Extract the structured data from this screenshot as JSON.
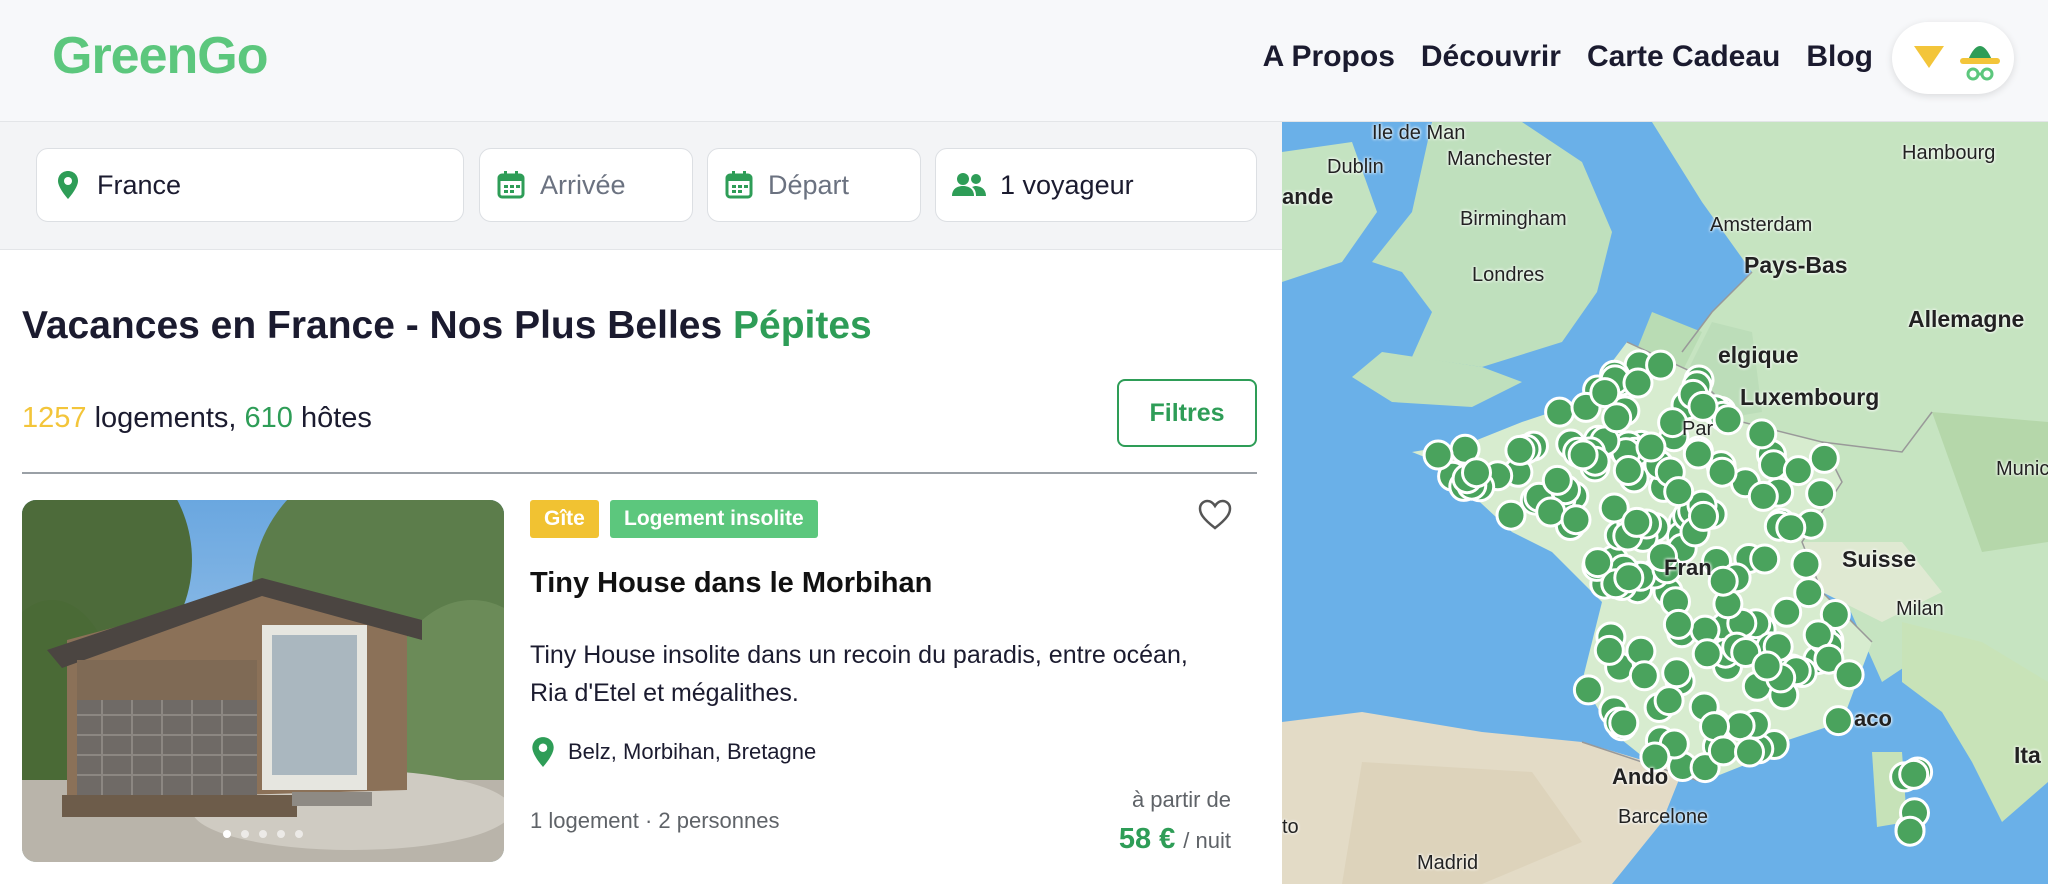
{
  "header": {
    "logo": {
      "green": "Green",
      "go": "Go"
    },
    "nav": [
      "A Propos",
      "Découvrir",
      "Carte Cadeau",
      "Blog"
    ],
    "menu_icon": "chevron-down-icon",
    "avatar_icon": "user-avatar-icon"
  },
  "search": {
    "destination": {
      "value": "France",
      "icon": "location-pin-icon"
    },
    "arrival": {
      "placeholder": "Arrivée",
      "icon": "calendar-icon"
    },
    "departure": {
      "placeholder": "Départ",
      "icon": "calendar-icon"
    },
    "travelers": {
      "value": "1 voyageur",
      "icon": "users-icon"
    }
  },
  "listing": {
    "title_main": "Vacances en France - Nos Plus Belles",
    "title_accent": "Pépites",
    "count_lodgings": "1257",
    "lodgings_label": "logements,",
    "count_hosts": "610",
    "hosts_label": "hôtes",
    "filters_label": "Filtres"
  },
  "card": {
    "badges": [
      "Gîte",
      "Logement insolite"
    ],
    "title": "Tiny House dans le Morbihan",
    "description": "Tiny House insolite dans un recoin du paradis, entre océan, Ria d'Etel et mégalithes.",
    "location": "Belz, Morbihan, Bretagne",
    "meta": "1 logement · 2 personnes",
    "price_prefix": "à partir de",
    "price": "58 €",
    "price_unit": "/ nuit",
    "image_dots": 5
  },
  "map": {
    "labels": [
      "Ile de Man",
      "Dublin",
      "ande",
      "Manchester",
      "Birmingham",
      "Londres",
      "Amsterdam",
      "Pays-Bas",
      "Hambourg",
      "Allemagne",
      "elgique",
      "Luxembourg",
      "Fran",
      "Suisse",
      "Munich",
      "Milan",
      "aco",
      "Ita",
      "Ando",
      "Barcelone",
      "Madrid",
      "to",
      "Par"
    ]
  },
  "colors": {
    "brand_green": "#2e9d57",
    "logo_green": "#5cc77d",
    "brand_yellow": "#f3c53a",
    "map_marker": "#4aa35d"
  }
}
